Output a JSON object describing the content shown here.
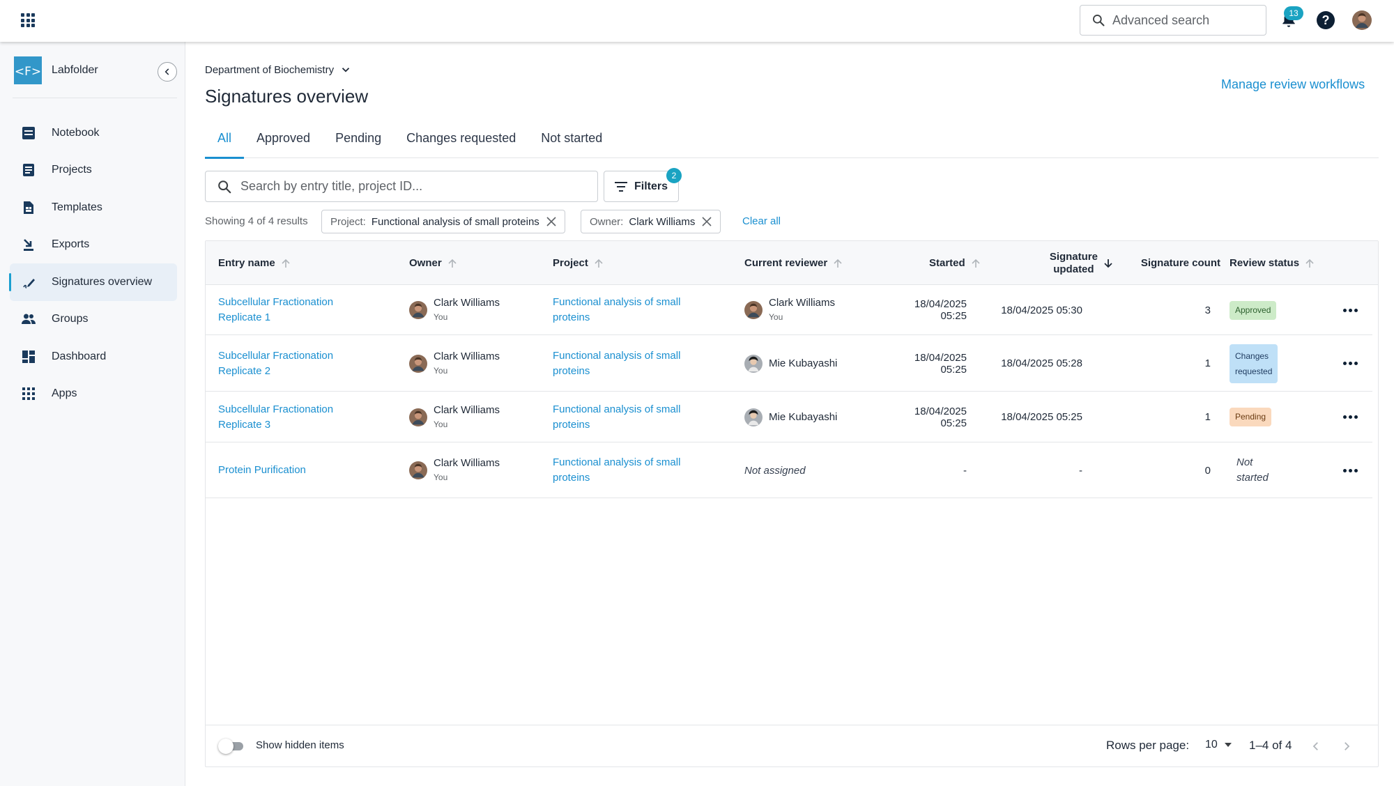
{
  "topbar": {
    "search_label": "Advanced search",
    "notification_count": "13"
  },
  "sidebar": {
    "brand": "Labfolder",
    "items": [
      {
        "label": "Notebook",
        "icon": "notebook-icon"
      },
      {
        "label": "Projects",
        "icon": "projects-icon"
      },
      {
        "label": "Templates",
        "icon": "templates-icon"
      },
      {
        "label": "Exports",
        "icon": "exports-icon"
      },
      {
        "label": "Signatures overview",
        "icon": "signature-icon",
        "active": true
      },
      {
        "label": "Groups",
        "icon": "groups-icon"
      },
      {
        "label": "Dashboard",
        "icon": "dashboard-icon"
      },
      {
        "label": "Apps",
        "icon": "apps-icon"
      }
    ]
  },
  "header": {
    "department": "Department of Biochemistry",
    "title": "Signatures overview",
    "manage_link": "Manage review workflows"
  },
  "tabs": [
    "All",
    "Approved",
    "Pending",
    "Changes requested",
    "Not started"
  ],
  "search": {
    "placeholder": "Search by entry title, project ID...",
    "filters_label": "Filters",
    "filters_count": "2"
  },
  "results": {
    "showing": "Showing 4 of 4 results",
    "chips": [
      {
        "key": "Project:",
        "value": "Functional analysis of small proteins"
      },
      {
        "key": "Owner:",
        "value": "Clark Williams"
      }
    ],
    "clear_all": "Clear all"
  },
  "table": {
    "columns": {
      "entry_name": "Entry name",
      "owner": "Owner",
      "project": "Project",
      "current_reviewer": "Current reviewer",
      "started": "Started",
      "signature_updated_1": "Signature",
      "signature_updated_2": "updated",
      "signature_count": "Signature count",
      "review_status": "Review status"
    },
    "rows": [
      {
        "entry_1": "Subcellular Fractionation",
        "entry_2": "Replicate 1",
        "owner": "Clark Williams",
        "owner_sub": "You",
        "project_1": "Functional analysis of small",
        "project_2": "proteins",
        "reviewer": "Clark Williams",
        "reviewer_sub": "You",
        "started": "18/04/2025 05:25",
        "updated": "18/04/2025 05:30",
        "count": "3",
        "status_1": "Approved",
        "status_2": ""
      },
      {
        "entry_1": "Subcellular Fractionation",
        "entry_2": "Replicate 2",
        "owner": "Clark Williams",
        "owner_sub": "You",
        "project_1": "Functional analysis of small",
        "project_2": "proteins",
        "reviewer": "Mie Kubayashi",
        "reviewer_sub": "",
        "started": "18/04/2025 05:25",
        "updated": "18/04/2025 05:28",
        "count": "1",
        "status_1": "Changes",
        "status_2": "requested"
      },
      {
        "entry_1": "Subcellular Fractionation",
        "entry_2": "Replicate 3",
        "owner": "Clark Williams",
        "owner_sub": "You",
        "project_1": "Functional analysis of small",
        "project_2": "proteins",
        "reviewer": "Mie Kubayashi",
        "reviewer_sub": "",
        "started": "18/04/2025 05:25",
        "updated": "18/04/2025 05:25",
        "count": "1",
        "status_1": "Pending",
        "status_2": ""
      },
      {
        "entry_1": "Protein Purification",
        "entry_2": "",
        "owner": "Clark Williams",
        "owner_sub": "You",
        "project_1": "Functional analysis of small",
        "project_2": "proteins",
        "reviewer": "Not assigned",
        "reviewer_sub": "",
        "started": "-",
        "updated": "-",
        "count": "0",
        "status_1": "Not",
        "status_2": "started"
      }
    ]
  },
  "footer": {
    "show_hidden": "Show hidden items",
    "rows_per_page_label": "Rows per page:",
    "rows_per_page_value": "10",
    "range": "1–4 of 4"
  },
  "colors": {
    "accent": "#1a8fd0",
    "badge": "#1aa3c2",
    "approved_bg": "#cdebc8",
    "changes_bg": "#bfe0f7",
    "pending_bg": "#fad9bd"
  }
}
